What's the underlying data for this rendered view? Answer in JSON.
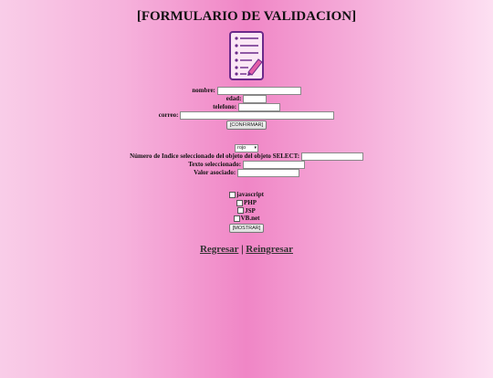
{
  "page": {
    "title": "[FORMULARIO DE VALIDACION]"
  },
  "form1": {
    "nombre_label": "nombre:",
    "edad_label": "edad:",
    "telefono_label": "telefono:",
    "correo_label": "correo:",
    "confirm_button": "[CONFIRMAR]"
  },
  "form2": {
    "select_value": "rojo",
    "index_label": "Número de Indice seleccionado del objeto del objeto SELECT:",
    "text_label": "Texto seleccionado:",
    "value_label": "Valor asociado:"
  },
  "form3": {
    "options": [
      "javascript",
      "PHP",
      "JSP",
      "VB.net"
    ],
    "show_button": "[MOSTRAR]"
  },
  "links": {
    "back": "Regresar",
    "separator": " | ",
    "reenter": "Reingresar"
  },
  "icons": {
    "form": "form-checklist-pencil-icon"
  },
  "colors": {
    "bg_center": "#f086c6",
    "bg_edge": "#fde0f2",
    "icon_frame": "#6b2a8a"
  }
}
